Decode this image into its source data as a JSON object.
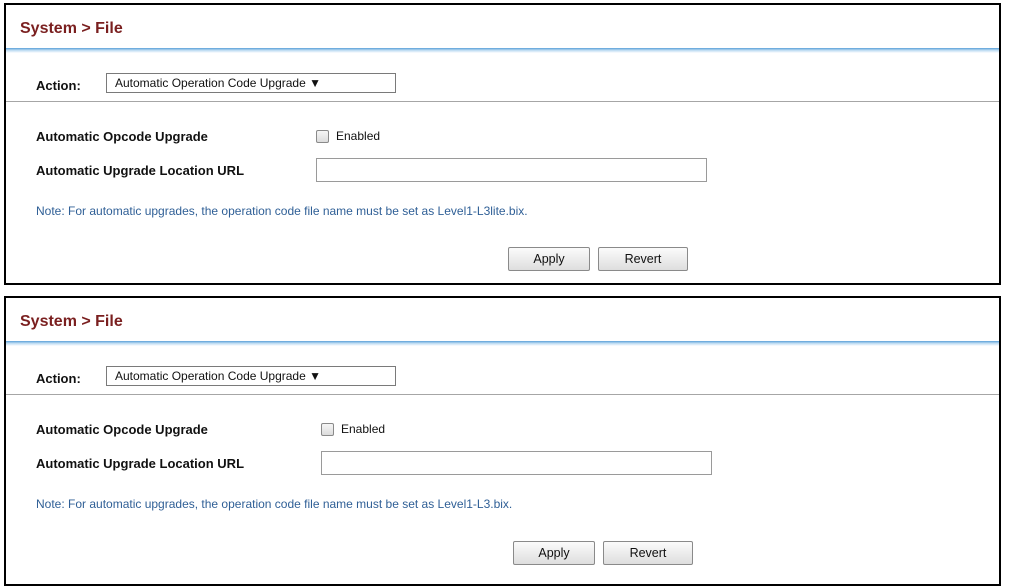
{
  "panels": [
    {
      "title": "System > File",
      "action_label": "Action:",
      "action_value": "Automatic Operation Code Upgrade ▼",
      "opcode_label": "Automatic Opcode Upgrade",
      "enabled_label": "Enabled",
      "url_label": "Automatic Upgrade Location URL",
      "url_value": "",
      "note": "Note: For automatic upgrades, the operation code file name must be set as Level1-L3lite.bix.",
      "apply_label": "Apply",
      "revert_label": "Revert"
    },
    {
      "title": "System > File",
      "action_label": "Action:",
      "action_value": "Automatic Operation Code Upgrade ▼",
      "opcode_label": "Automatic Opcode Upgrade",
      "enabled_label": "Enabled",
      "url_label": "Automatic Upgrade Location URL",
      "url_value": "",
      "note": "Note: For automatic upgrades, the operation code file name must be set as Level1-L3.bix.",
      "apply_label": "Apply",
      "revert_label": "Revert"
    }
  ]
}
